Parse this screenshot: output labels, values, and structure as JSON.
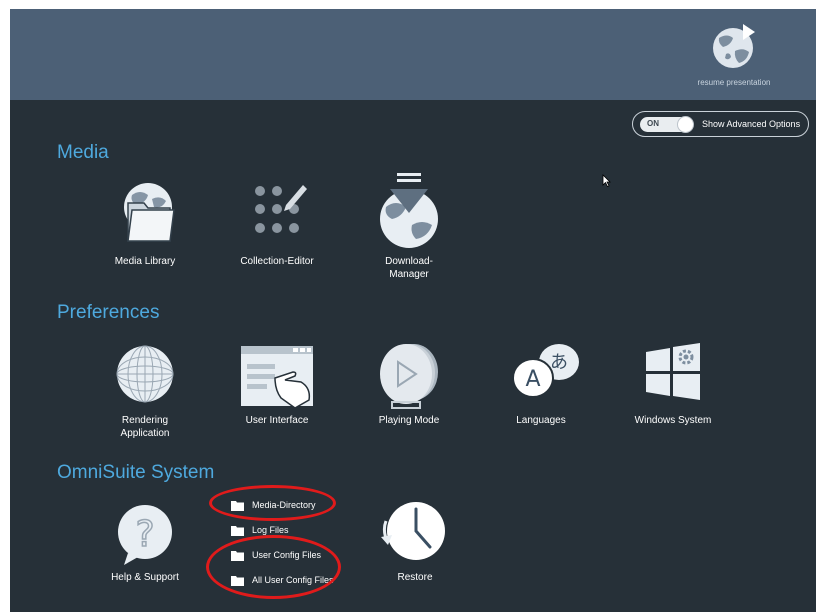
{
  "header": {
    "resume_label": "resume presentation"
  },
  "advanced_toggle": {
    "state": "ON",
    "label": "Show Advanced Options"
  },
  "sections": {
    "media": {
      "title": "Media",
      "items": [
        {
          "label": "Media Library",
          "icon": "globe-folder-icon"
        },
        {
          "label": "Collection-Editor",
          "icon": "dot-grid-pencil-icon"
        },
        {
          "label": "Download-",
          "label2": "Manager",
          "icon": "globe-download-icon"
        }
      ]
    },
    "preferences": {
      "title": "Preferences",
      "items": [
        {
          "label": "Rendering",
          "label2": "Application",
          "icon": "wireframe-sphere-icon"
        },
        {
          "label": "User Interface",
          "icon": "window-hand-icon"
        },
        {
          "label": "Playing Mode",
          "icon": "play-stack-icon"
        },
        {
          "label": "Languages",
          "icon": "language-bubbles-icon"
        },
        {
          "label": "Windows System",
          "icon": "windows-gear-icon"
        }
      ]
    },
    "system": {
      "title": "OmniSuite System",
      "help": {
        "label": "Help & Support",
        "icon": "question-bubble-icon"
      },
      "files": [
        {
          "label": "Media-Directory"
        },
        {
          "label": "Log Files"
        },
        {
          "label": "User Config Files"
        },
        {
          "label": "All User Config Files"
        }
      ],
      "restore": {
        "label": "Restore",
        "icon": "clock-restore-icon"
      }
    }
  },
  "colors": {
    "background": "#263038",
    "header": "#4c6076",
    "section_title": "#4ea9de",
    "callout": "#e01b1b"
  }
}
